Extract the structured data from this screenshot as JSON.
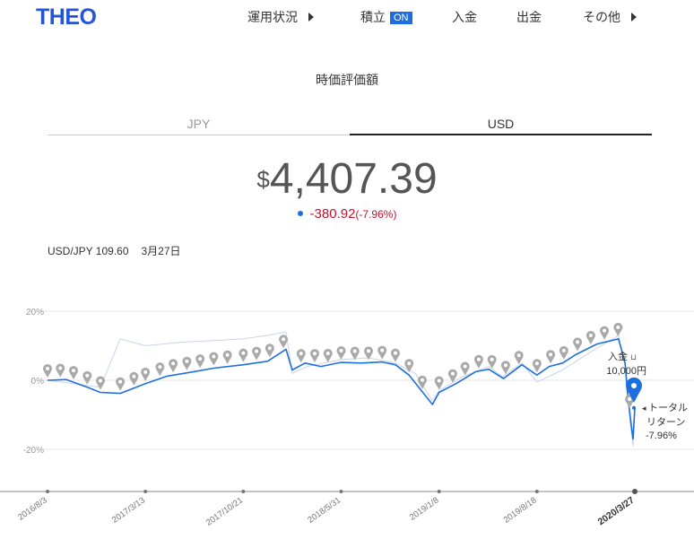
{
  "header": {
    "logo": "THEO",
    "nav": {
      "performance": "運用状況",
      "savings": "積立",
      "savings_badge": "ON",
      "deposit": "入金",
      "withdraw": "出金",
      "more": "その他"
    }
  },
  "section_title": "時価評価額",
  "tabs": {
    "jpy": "JPY",
    "usd": "USD"
  },
  "valuation": {
    "currency_symbol": "$",
    "amount": "4,407.39",
    "change": "-380.92",
    "change_pct": "(-7.96%)"
  },
  "fx": {
    "rate": "USD/JPY 109.60",
    "date": "3月27日"
  },
  "colors": {
    "accent": "#1d6fe0",
    "negative": "#c8102e",
    "benchmark": "#c9d3ea",
    "marker": "#a9a9a9"
  },
  "chart_data": {
    "type": "line",
    "y_unit": "%",
    "ylim": [
      -24,
      24
    ],
    "y_ticks": [
      "20%",
      "0%",
      "-20%"
    ],
    "x_ticks": [
      "2016/8/3",
      "2017/3/13",
      "2017/10/21",
      "2018/5/31",
      "2019/1/8",
      "2019/8/18",
      "2020/3/27"
    ],
    "x_range": [
      "2016-08-03",
      "2020-03-27"
    ],
    "grid": true,
    "series": [
      {
        "style": "primary",
        "points": [
          [
            "2016-08-03",
            0.0
          ],
          [
            "2016-09-15",
            0.2
          ],
          [
            "2016-11-01",
            -2.0
          ],
          [
            "2016-12-01",
            -3.5
          ],
          [
            "2017-01-15",
            -3.8
          ],
          [
            "2017-03-13",
            -1.0
          ],
          [
            "2017-05-01",
            1.2
          ],
          [
            "2017-07-01",
            2.5
          ],
          [
            "2017-08-15",
            3.5
          ],
          [
            "2017-10-21",
            4.5
          ],
          [
            "2017-12-15",
            5.5
          ],
          [
            "2018-01-26",
            9.0
          ],
          [
            "2018-02-09",
            3.0
          ],
          [
            "2018-03-10",
            5.0
          ],
          [
            "2018-04-15",
            4.0
          ],
          [
            "2018-05-31",
            5.2
          ],
          [
            "2018-07-15",
            5.0
          ],
          [
            "2018-09-01",
            5.3
          ],
          [
            "2018-10-01",
            4.5
          ],
          [
            "2018-11-01",
            1.5
          ],
          [
            "2018-12-24",
            -7.0
          ],
          [
            "2019-01-08",
            -3.5
          ],
          [
            "2019-02-15",
            -1.0
          ],
          [
            "2019-04-01",
            2.5
          ],
          [
            "2019-05-01",
            3.2
          ],
          [
            "2019-06-03",
            0.5
          ],
          [
            "2019-07-15",
            4.5
          ],
          [
            "2019-08-18",
            1.5
          ],
          [
            "2019-09-15",
            4.0
          ],
          [
            "2019-10-15",
            5.0
          ],
          [
            "2019-11-15",
            7.5
          ],
          [
            "2020-01-01",
            10.5
          ],
          [
            "2020-02-19",
            12.0
          ],
          [
            "2020-03-05",
            5.0
          ],
          [
            "2020-03-10",
            -3.0
          ],
          [
            "2020-03-16",
            -10.0
          ],
          [
            "2020-03-23",
            -17.0
          ],
          [
            "2020-03-27",
            -8.0
          ]
        ]
      },
      {
        "style": "benchmark",
        "points": [
          [
            "2016-08-03",
            0.0
          ],
          [
            "2016-10-01",
            -1.0
          ],
          [
            "2016-12-01",
            -2.0
          ],
          [
            "2017-01-15",
            12.0
          ],
          [
            "2017-03-13",
            10.0
          ],
          [
            "2017-06-01",
            11.0
          ],
          [
            "2017-08-15",
            11.5
          ],
          [
            "2017-10-21",
            12.0
          ],
          [
            "2017-12-15",
            13.0
          ],
          [
            "2018-01-26",
            14.0
          ],
          [
            "2018-02-09",
            2.0
          ],
          [
            "2018-03-15",
            4.0
          ],
          [
            "2018-05-31",
            6.0
          ],
          [
            "2018-08-01",
            6.5
          ],
          [
            "2018-10-01",
            5.0
          ],
          [
            "2018-11-15",
            2.0
          ],
          [
            "2018-12-24",
            -6.0
          ],
          [
            "2019-01-08",
            -3.0
          ],
          [
            "2019-03-01",
            1.0
          ],
          [
            "2019-05-01",
            4.0
          ],
          [
            "2019-06-01",
            1.0
          ],
          [
            "2019-07-15",
            5.0
          ],
          [
            "2019-08-18",
            -0.5
          ],
          [
            "2019-10-15",
            3.0
          ],
          [
            "2019-12-15",
            8.0
          ],
          [
            "2020-02-19",
            13.0
          ],
          [
            "2020-03-05",
            4.0
          ],
          [
            "2020-03-16",
            -12.0
          ],
          [
            "2020-03-23",
            -19.0
          ],
          [
            "2020-03-27",
            -9.0
          ]
        ]
      }
    ],
    "deposit_markers": [
      "2016-08-03",
      "2016-09-01",
      "2016-10-01",
      "2016-11-01",
      "2016-12-01",
      "2017-01-15",
      "2017-02-15",
      "2017-03-13",
      "2017-04-15",
      "2017-05-15",
      "2017-06-15",
      "2017-07-15",
      "2017-08-15",
      "2017-09-15",
      "2017-10-21",
      "2017-11-20",
      "2017-12-20",
      "2018-01-20",
      "2018-03-01",
      "2018-04-01",
      "2018-05-01",
      "2018-05-31",
      "2018-07-01",
      "2018-08-01",
      "2018-09-01",
      "2018-10-01",
      "2018-11-01",
      "2018-12-01",
      "2019-01-08",
      "2019-02-08",
      "2019-03-08",
      "2019-04-08",
      "2019-05-08",
      "2019-06-08",
      "2019-07-08",
      "2019-08-18",
      "2019-09-18",
      "2019-10-18",
      "2019-11-18",
      "2019-12-18",
      "2020-01-18",
      "2020-02-18",
      "2020-03-15"
    ],
    "annotations": {
      "deposit": {
        "label": "入金",
        "amount": "10,000円"
      },
      "total_return": {
        "label1": "トータル",
        "label2": "リターン",
        "value": "-7.96%"
      }
    }
  }
}
